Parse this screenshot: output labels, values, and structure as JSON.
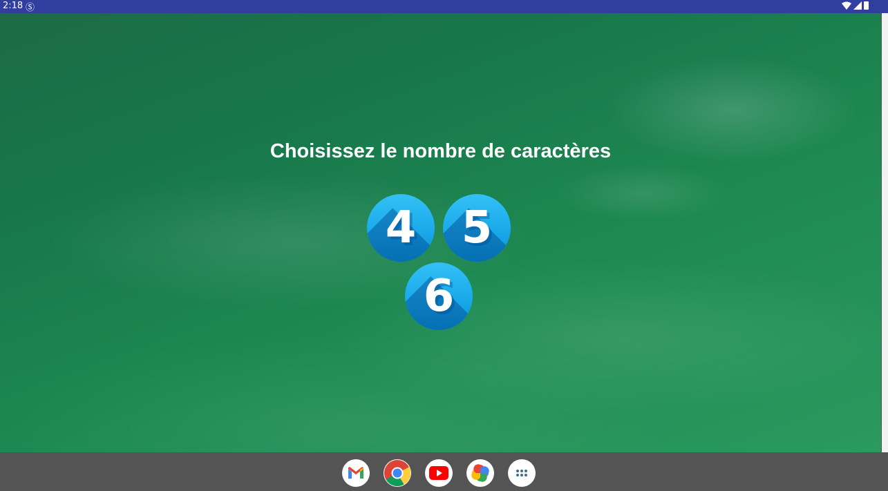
{
  "status_bar": {
    "time": "2:18",
    "app_icon": "keyboard-s-icon"
  },
  "screen": {
    "title": "Choisissez le nombre de caractères",
    "options": [
      {
        "label": "4"
      },
      {
        "label": "5"
      },
      {
        "label": "6"
      }
    ]
  },
  "dock": {
    "apps": [
      "gmail-icon",
      "chrome-icon",
      "youtube-icon",
      "photos-icon",
      "app-drawer-icon"
    ]
  },
  "colors": {
    "status_bar": "#303f9f",
    "board": "#1e8a52",
    "button": "#1aa9ea",
    "taskbar": "#545454"
  }
}
